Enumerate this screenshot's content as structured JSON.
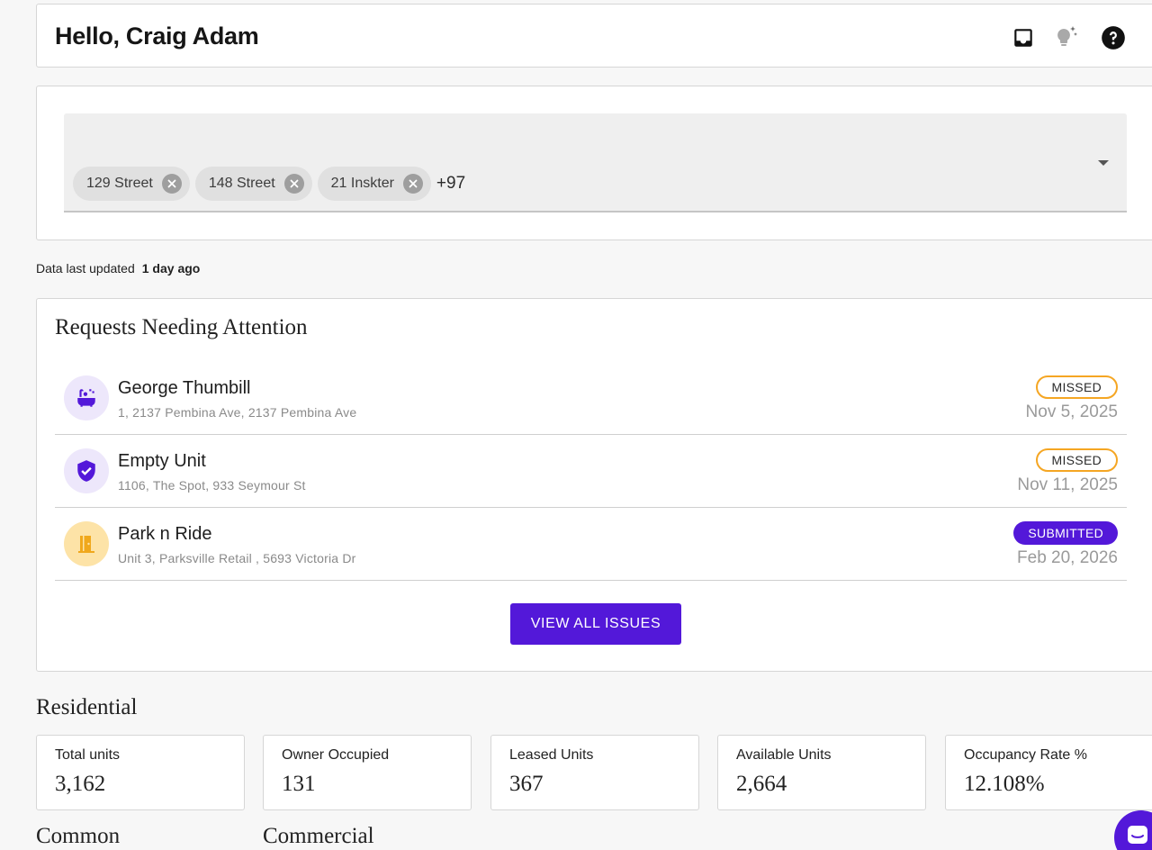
{
  "header": {
    "greeting": "Hello, Craig Adam",
    "icons": [
      "inbox-icon",
      "lightbulb-sparkle-icon",
      "help-icon"
    ]
  },
  "filter": {
    "chips": [
      "129 Street",
      "148 Street",
      "21 Inskter"
    ],
    "more_count": "+97"
  },
  "updated": {
    "label": "Data last updated",
    "value": "1 day ago"
  },
  "requests": {
    "title": "Requests Needing Attention",
    "items": [
      {
        "name": "George Thumbill",
        "address": "1, 2137 Pembina Ave, 2137 Pembina Ave",
        "status": "MISSED",
        "date": "Nov 5, 2025",
        "icon": "bathtub-icon"
      },
      {
        "name": "Empty Unit",
        "address": "1106, The Spot, 933 Seymour St",
        "status": "MISSED",
        "date": "Nov 11, 2025",
        "icon": "shield-check-icon"
      },
      {
        "name": "Park n Ride",
        "address": "Unit 3, Parksville Retail , 5693 Victoria Dr",
        "status": "SUBMITTED",
        "date": "Feb 20, 2026",
        "icon": "door-icon"
      }
    ],
    "view_all_label": "VIEW ALL ISSUES"
  },
  "residential": {
    "title": "Residential",
    "stats": [
      {
        "label": "Total units",
        "value": "3,162"
      },
      {
        "label": "Owner Occupied",
        "value": "131"
      },
      {
        "label": "Leased Units",
        "value": "367"
      },
      {
        "label": "Available Units",
        "value": "2,664"
      },
      {
        "label": "Occupancy Rate %",
        "value": "12.108%"
      }
    ]
  },
  "sections": {
    "common": "Common",
    "commercial": "Commercial"
  },
  "colors": {
    "accent": "#5318d9",
    "missed": "#f5a623",
    "avatar_purple_bg": "#ede7fb",
    "avatar_orange_bg": "#fde3a7",
    "door_orange": "#f0a81c"
  }
}
